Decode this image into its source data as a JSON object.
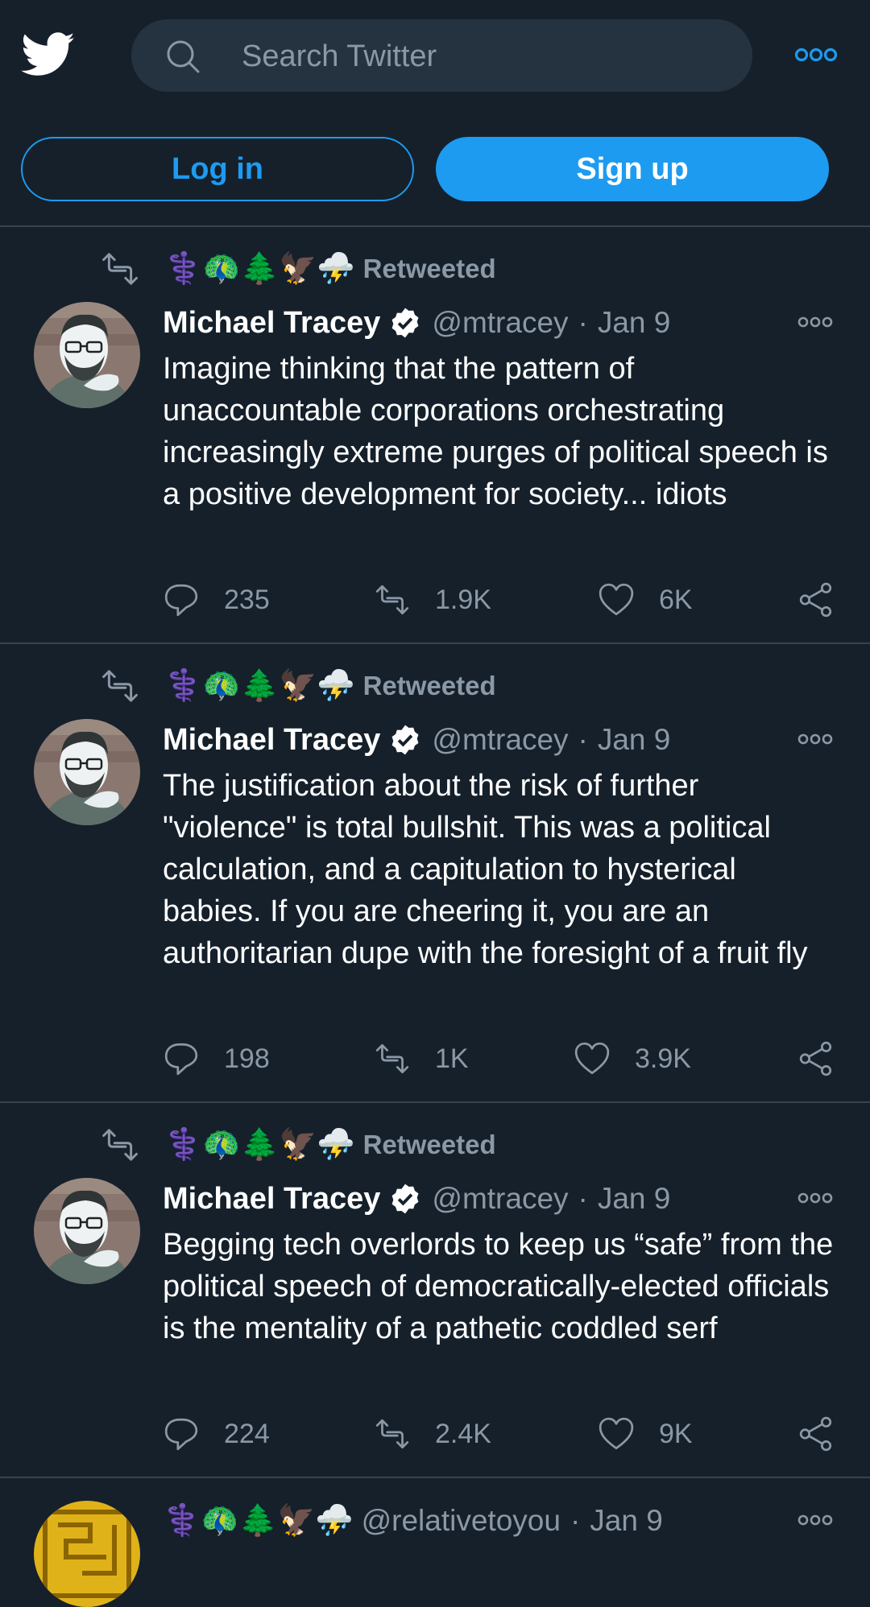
{
  "header": {
    "search_placeholder": "Search Twitter",
    "login_label": "Log in",
    "signup_label": "Sign up"
  },
  "colors": {
    "background": "#15202b",
    "accent": "#1d9bf0",
    "muted": "#8b98a5",
    "divider": "#38444d"
  },
  "tweets": [
    {
      "rt_emojis": "⚕️🦚🌲🦅⛈️",
      "rt_label": "Retweeted",
      "name": "Michael Tracey",
      "handle": "@mtracey",
      "dot": "·",
      "date": "Jan 9",
      "text": "Imagine thinking that the pattern of unaccountable corporations orchestrating increasingly extreme purges of political speech is a positive development for society... idiots",
      "replies": "235",
      "retweets": "1.9K",
      "likes": "6K"
    },
    {
      "rt_emojis": "⚕️🦚🌲🦅⛈️",
      "rt_label": "Retweeted",
      "name": "Michael Tracey",
      "handle": "@mtracey",
      "dot": "·",
      "date": "Jan 9",
      "text": "The justification about the risk of further \"violence\" is total bullshit. This was a political calculation, and a capitulation to hysterical babies. If you are cheering it, you are an authoritarian dupe with the foresight of a fruit fly",
      "replies": "198",
      "retweets": "1K",
      "likes": "3.9K"
    },
    {
      "rt_emojis": "⚕️🦚🌲🦅⛈️",
      "rt_label": "Retweeted",
      "name": "Michael Tracey",
      "handle": "@mtracey",
      "dot": "·",
      "date": "Jan 9",
      "text": "Begging tech overlords to keep us “safe” from the political speech of democratically-elected officials is the mentality of a pathetic coddled serf",
      "replies": "224",
      "retweets": "2.4K",
      "likes": "9K"
    },
    {
      "name_emojis": "⚕️🦚🌲🦅⛈️",
      "handle": "@relativetoyou",
      "dot": "·",
      "date": "Jan 9"
    }
  ]
}
